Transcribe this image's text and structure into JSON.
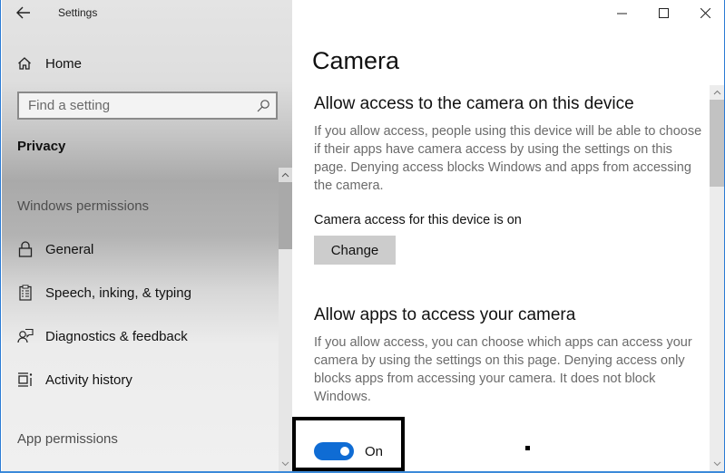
{
  "window": {
    "app_title": "Settings",
    "controls": {
      "minimize": "minimize-icon",
      "maximize": "maximize-icon",
      "close": "close-icon"
    }
  },
  "sidebar": {
    "back_icon": "arrow-left-icon",
    "home": {
      "label": "Home",
      "icon": "home-icon"
    },
    "search": {
      "placeholder": "Find a setting",
      "value": "",
      "icon": "search-icon"
    },
    "section_title": "Privacy",
    "groups": [
      {
        "header": "Windows permissions",
        "items": [
          {
            "label": "General",
            "icon": "lock-icon"
          },
          {
            "label": "Speech, inking, & typing",
            "icon": "clipboard-icon"
          },
          {
            "label": "Diagnostics & feedback",
            "icon": "person-feedback-icon"
          },
          {
            "label": "Activity history",
            "icon": "activity-history-icon"
          }
        ]
      },
      {
        "header": "App permissions",
        "items": []
      }
    ]
  },
  "main": {
    "page_title": "Camera",
    "device_section": {
      "heading": "Allow access to the camera on this device",
      "description": "If you allow access, people using this device will be able to choose if their apps have camera access by using the settings on this page. Denying access blocks Windows and apps from accessing the camera.",
      "status": "Camera access for this device is on",
      "button_label": "Change"
    },
    "apps_section": {
      "heading": "Allow apps to access your camera",
      "description": "If you allow access, you can choose which apps can access your camera by using the settings on this page. Denying access only blocks apps from accessing your camera. It does not block Windows.",
      "toggle": {
        "state": true,
        "label": "On"
      }
    }
  },
  "colors": {
    "accent": "#0f6cd4",
    "button_bg": "#cccccc",
    "description_text": "#6b6b6b"
  }
}
